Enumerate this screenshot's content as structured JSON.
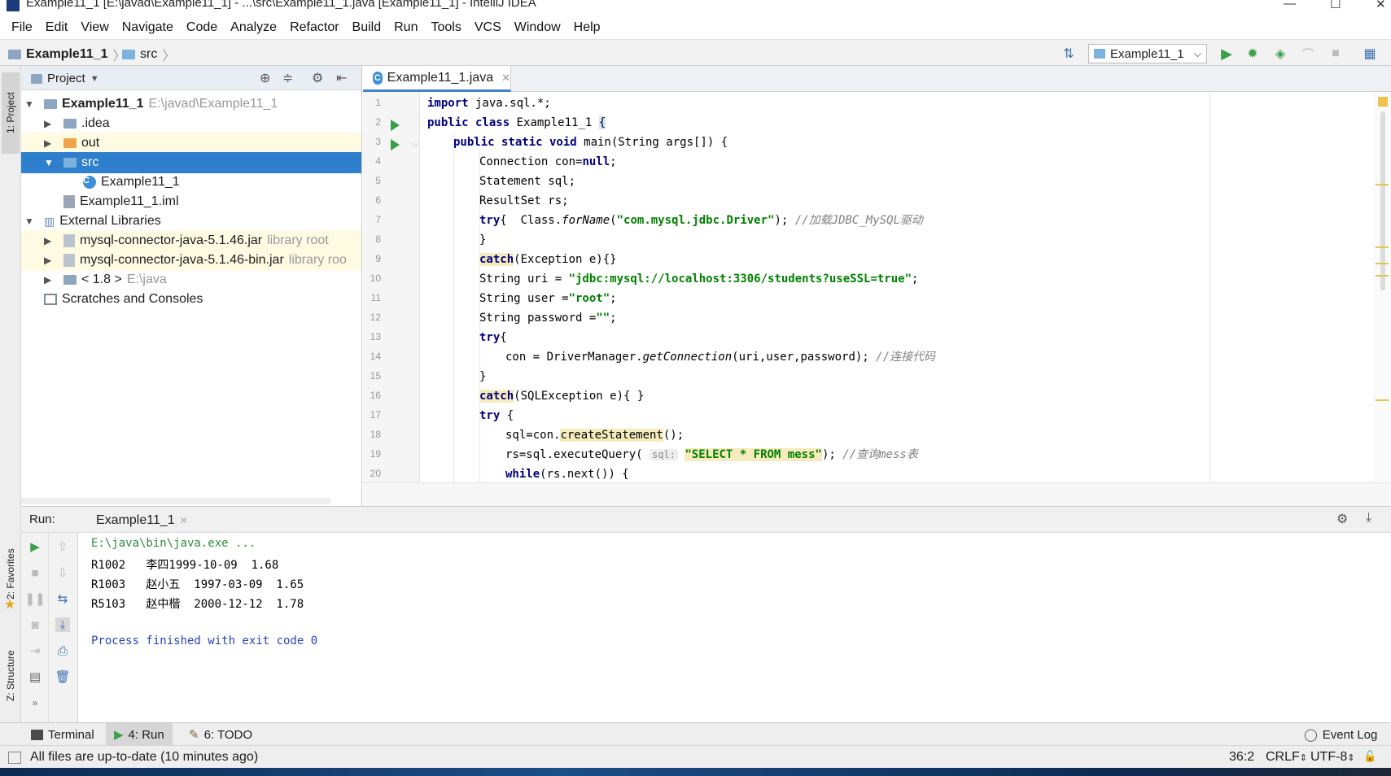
{
  "window": {
    "title": "Example11_1 [E:\\javad\\Example11_1] - ...\\src\\Example11_1.java [Example11_1] - IntelliJ IDEA"
  },
  "menu": [
    "File",
    "Edit",
    "View",
    "Navigate",
    "Code",
    "Analyze",
    "Refactor",
    "Build",
    "Run",
    "Tools",
    "VCS",
    "Window",
    "Help"
  ],
  "breadcrumb": {
    "project": "Example11_1",
    "folder": "src"
  },
  "run_config": {
    "selected": "Example11_1"
  },
  "side_tabs": {
    "project": "1: Project",
    "favorites": "2: Favorites",
    "structure": "Z: Structure"
  },
  "project_panel": {
    "title": "Project",
    "tree": [
      {
        "label": "Example11_1",
        "hint": "E:\\javad\\Example11_1"
      },
      {
        "label": ".idea"
      },
      {
        "label": "out"
      },
      {
        "label": "src"
      },
      {
        "label": "Example11_1"
      },
      {
        "label": "Example11_1.iml"
      },
      {
        "label": "External Libraries"
      },
      {
        "label": "mysql-connector-java-5.1.46.jar",
        "hint": "library root"
      },
      {
        "label": "mysql-connector-java-5.1.46-bin.jar",
        "hint": "library roo"
      },
      {
        "label": "< 1.8 >",
        "hint": "E:\\java"
      },
      {
        "label": "Scratches and Consoles"
      }
    ]
  },
  "editor": {
    "tab": "Example11_1.java",
    "line_numbers": [
      "1",
      "2",
      "3",
      "4",
      "5",
      "6",
      "7",
      "8",
      "9",
      "10",
      "11",
      "12",
      "13",
      "14",
      "15",
      "16",
      "17",
      "18",
      "19",
      "20"
    ],
    "code": {
      "l1_kw": "import",
      "l1_rest": " java.sql.*;",
      "l2_kw": "public class",
      "l2_rest": " Example11_1 ",
      "l2_brace": "{",
      "l3_kw": "public static void",
      "l3_rest": " main(String args[]) {",
      "l4_a": "Connection con=",
      "l4_kw": "null",
      "l4_b": ";",
      "l5": "Statement sql;",
      "l6": "ResultSet rs;",
      "l7_kw": "try",
      "l7_a": "{  Class.",
      "l7_m": "forName",
      "l7_b": "(",
      "l7_str": "\"com.mysql.jdbc.Driver\"",
      "l7_c": "); ",
      "l7_cmt": "//加载JDBC_MySQL驱动",
      "l8": "}",
      "l9_kw": "catch",
      "l9_rest": "(Exception e){}",
      "l10_a": "String uri = ",
      "l10_str": "\"jdbc:mysql://localhost:3306/students?useSSL=true\"",
      "l10_b": ";",
      "l11_a": "String user =",
      "l11_str": "\"root\"",
      "l11_b": ";",
      "l12_a": "String password =",
      "l12_str": "\"\"",
      "l12_b": ";",
      "l13_kw": "try",
      "l13_rest": "{",
      "l14_a": "con = DriverManager.",
      "l14_m": "getConnection",
      "l14_b": "(uri,user,password); ",
      "l14_cmt": "//连接代码",
      "l15": "}",
      "l16_kw": "catch",
      "l16_rest": "(SQLException e){ }",
      "l17_kw": "try",
      "l17_rest": " {",
      "l18_a": "sql=con.",
      "l18_m": "createStatement",
      "l18_b": "();",
      "l19_a": "rs=sql.executeQuery( ",
      "l19_hint": "sql:",
      "l19_str": "\"SELECT * FROM mess\"",
      "l19_b": "); ",
      "l19_cmt": "//查询mess表",
      "l20_kw": "while",
      "l20_rest": "(rs.next()) {"
    }
  },
  "run_panel": {
    "label": "Run:",
    "tab": "Example11_1",
    "output": [
      "E:\\java\\bin\\java.exe ...",
      "R1002   李四1999-10-09  1.68",
      "R1003   赵小五  1997-03-09  1.65",
      "R5103   赵中楷  2000-12-12  1.78",
      "",
      "Process finished with exit code 0"
    ]
  },
  "tool_windows": {
    "terminal": "Terminal",
    "run": "4: Run",
    "todo": "6: TODO",
    "event_log": "Event Log"
  },
  "status_bar": {
    "message": "All files are up-to-date (10 minutes ago)",
    "position": "36:2",
    "line_sep": "CRLF",
    "encoding": "UTF-8"
  },
  "colors": {
    "selection": "#2f7fcf",
    "keyword": "#000080",
    "string": "#008000",
    "run_green": "#3aa047"
  }
}
